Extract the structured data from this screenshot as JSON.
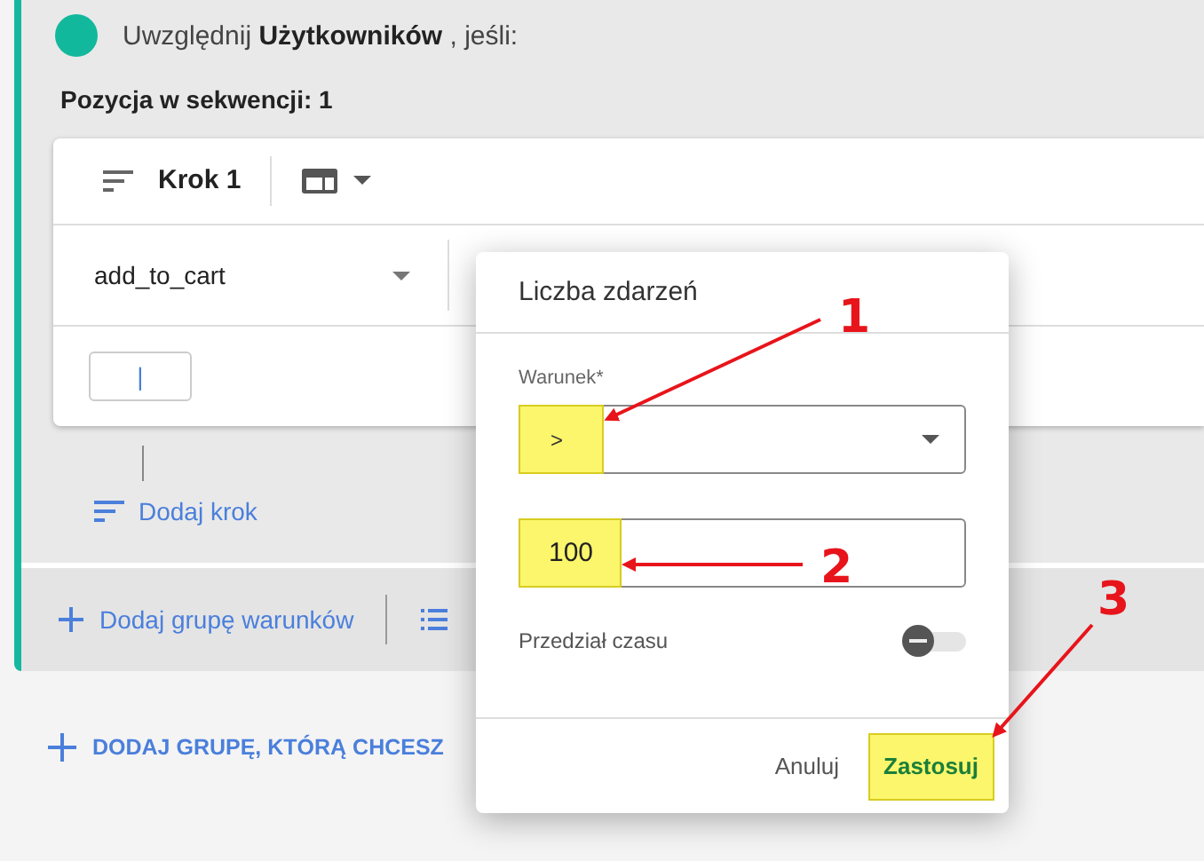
{
  "group": {
    "prefix": "Uwzględnij",
    "subject": "Użytkowników",
    "suffix": ", jeśli:",
    "sequence_label": "Pozycja w sekwencji: 1"
  },
  "step": {
    "title": "Krok 1",
    "event": "add_to_cart",
    "value_box": "|"
  },
  "add_step": "Dodaj krok",
  "group_actions": [
    {
      "kind": "plus",
      "label": "Dodaj grupę warunków"
    },
    {
      "kind": "list"
    }
  ],
  "add_exclude_group": "DODAJ GRUPĘ, KTÓRĄ CHCESZ",
  "dialog": {
    "title": "Liczba zdarzeń",
    "condition_label": "Warunek*",
    "condition_value": ">",
    "condition_highlighted": true,
    "count_value": "100",
    "count_highlighted": true,
    "time_range_label": "Przedział czasu",
    "time_range_on": false,
    "buttons": [
      {
        "label": "Anuluj",
        "kind": "text",
        "highlighted": false
      },
      {
        "label": "Zastosuj",
        "kind": "primary",
        "highlighted": true
      }
    ]
  },
  "annotations": [
    "1",
    "2",
    "3"
  ]
}
